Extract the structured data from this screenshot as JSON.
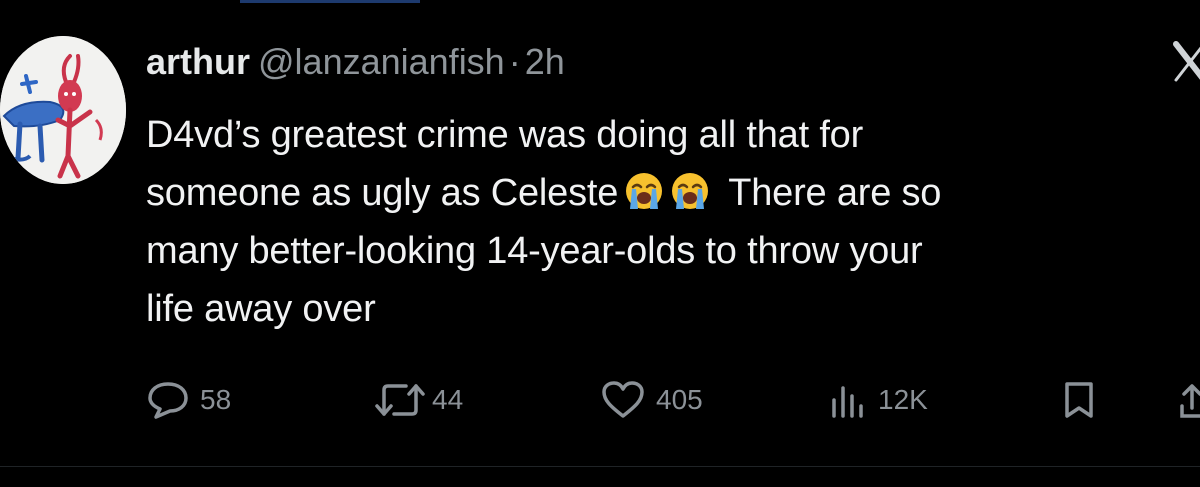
{
  "tweet": {
    "author_name": "arthur",
    "author_handle": "@lanzanianfish",
    "separator": "·",
    "time_ago": "2h",
    "text_lines": [
      "D4vd’s greatest crime was doing all that for",
      "someone as ugly as Celeste",
      "There are so",
      "many better-looking 14-year-olds to throw your",
      "life away over"
    ],
    "emojis": [
      "loudly-crying-face",
      "loudly-crying-face"
    ]
  },
  "actions": {
    "replies": "58",
    "reposts": "44",
    "likes": "405",
    "views": "12K"
  },
  "icons": {
    "reply": "reply-icon",
    "repost": "repost-icon",
    "like": "heart-icon",
    "views": "views-icon",
    "bookmark": "bookmark-icon",
    "share": "share-icon",
    "more": "more-icon"
  },
  "colors": {
    "background": "#000000",
    "text": "#e7e9ea",
    "secondary_text": "#8f959a",
    "icon": "#8b9197"
  }
}
